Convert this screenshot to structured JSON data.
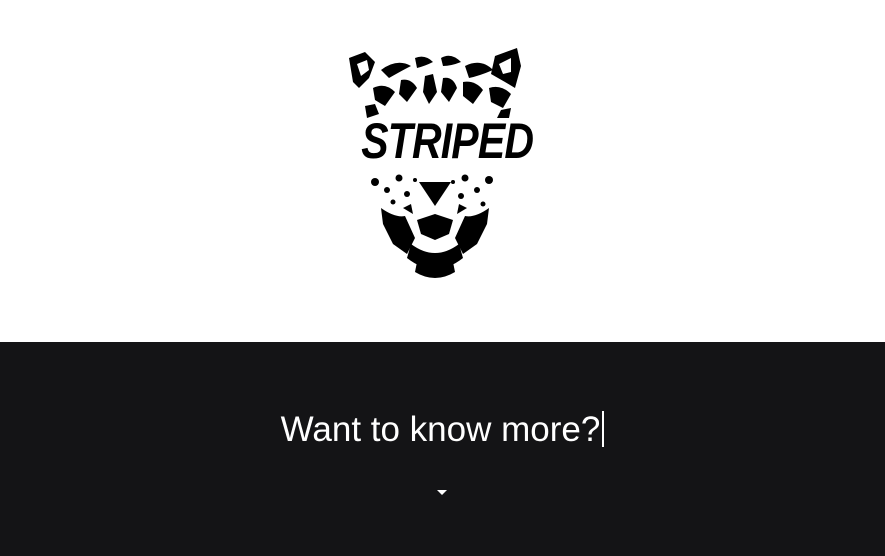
{
  "brand": {
    "logo_text": "STRIPED",
    "logo_icon": "leopard-head-icon"
  },
  "cta": {
    "headline": "Want to know more?",
    "expand_icon": "caret-down-icon"
  },
  "colors": {
    "hero_bg": "#ffffff",
    "footer_bg": "#141416",
    "logo": "#000000",
    "footer_text": "#ffffff"
  }
}
